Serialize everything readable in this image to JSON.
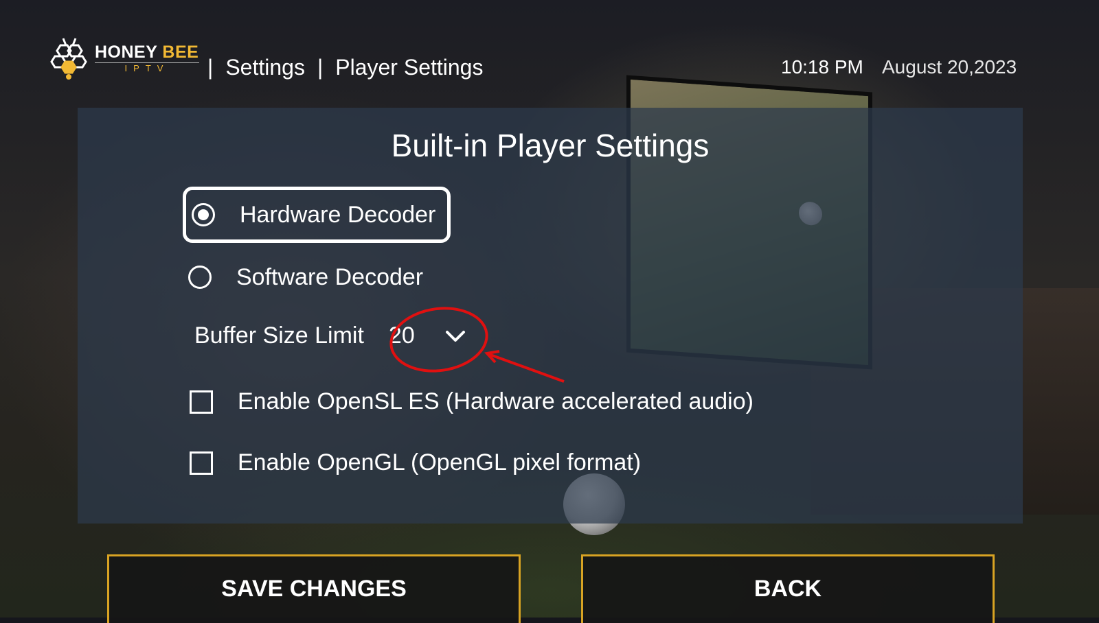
{
  "app": {
    "logo_primary_a": "HONEY",
    "logo_primary_b": "BEE",
    "logo_sub": "IPTV"
  },
  "header": {
    "breadcrumb": [
      "Settings",
      "Player Settings"
    ],
    "time": "10:18 PM",
    "date": "August 20,2023"
  },
  "panel": {
    "title": "Built-in Player Settings",
    "decoder_options": [
      {
        "label": "Hardware Decoder",
        "selected": true
      },
      {
        "label": "Software Decoder",
        "selected": false
      }
    ],
    "buffer": {
      "label": "Buffer Size Limit",
      "value": "20"
    },
    "checkboxes": [
      {
        "label": "Enable OpenSL ES (Hardware accelerated audio)",
        "checked": false
      },
      {
        "label": "Enable OpenGL (OpenGL pixel format)",
        "checked": false
      }
    ]
  },
  "buttons": {
    "save": "SAVE CHANGES",
    "back": "BACK"
  },
  "colors": {
    "accent_gold": "#d8a323",
    "annotation_red": "#e01010",
    "panel_overlay": "#2c3a4c"
  },
  "icons": [
    "honeycomb-logo-icon",
    "radio-selected-icon",
    "radio-unselected-icon",
    "chevron-down-icon",
    "checkbox-icon"
  ]
}
